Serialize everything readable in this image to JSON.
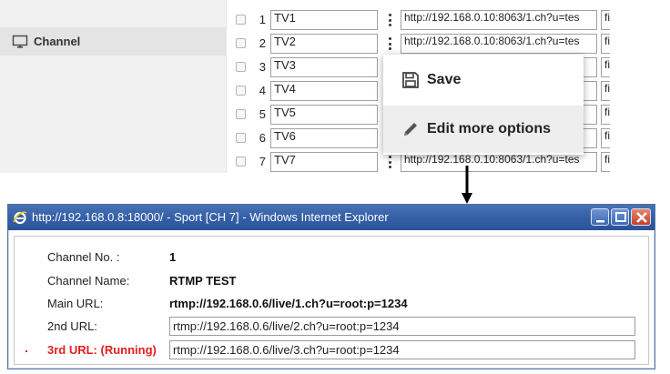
{
  "sidebar": {
    "channel_label": "Channel"
  },
  "channel_rows": [
    {
      "num": "1",
      "name": "TV1",
      "url": "http://192.168.0.10:8063/1.ch?u=tes",
      "extra": "fi"
    },
    {
      "num": "2",
      "name": "TV2",
      "url": "http://192.168.0.10:8063/1.ch?u=tes",
      "extra": "fi"
    },
    {
      "num": "3",
      "name": "TV3",
      "url": "",
      "extra": "fi"
    },
    {
      "num": "4",
      "name": "TV4",
      "url": "",
      "extra": "fi"
    },
    {
      "num": "5",
      "name": "TV5",
      "url": "",
      "extra": "fi"
    },
    {
      "num": "6",
      "name": "TV6",
      "url": "",
      "extra": "fi"
    },
    {
      "num": "7",
      "name": "TV7",
      "url": "http://192.168.0.10:8063/1.ch?u=tes",
      "extra": "fi"
    }
  ],
  "popup_menu": {
    "save_label": "Save",
    "edit_label": "Edit more options"
  },
  "ie_window": {
    "title": "http://192.168.0.8:18000/ - Sport [CH 7] - Windows Internet Explorer",
    "fields": {
      "channel_no_label": "Channel No. :",
      "channel_no_value": "1",
      "channel_name_label": "Channel Name:",
      "channel_name_value": "RTMP TEST",
      "main_url_label": "Main URL:",
      "main_url_value": "rtmp://192.168.0.6/live/1.ch?u=root:p=1234",
      "url2_label": "2nd URL:",
      "url2_value": "rtmp://192.168.0.6/live/2.ch?u=root:p=1234",
      "url3_label": "3rd URL: (Running)",
      "url3_value": "rtmp://192.168.0.6/live/3.ch?u=root:p=1234"
    }
  },
  "colors": {
    "running": "#e02020",
    "titlebar": "#3560a8"
  }
}
